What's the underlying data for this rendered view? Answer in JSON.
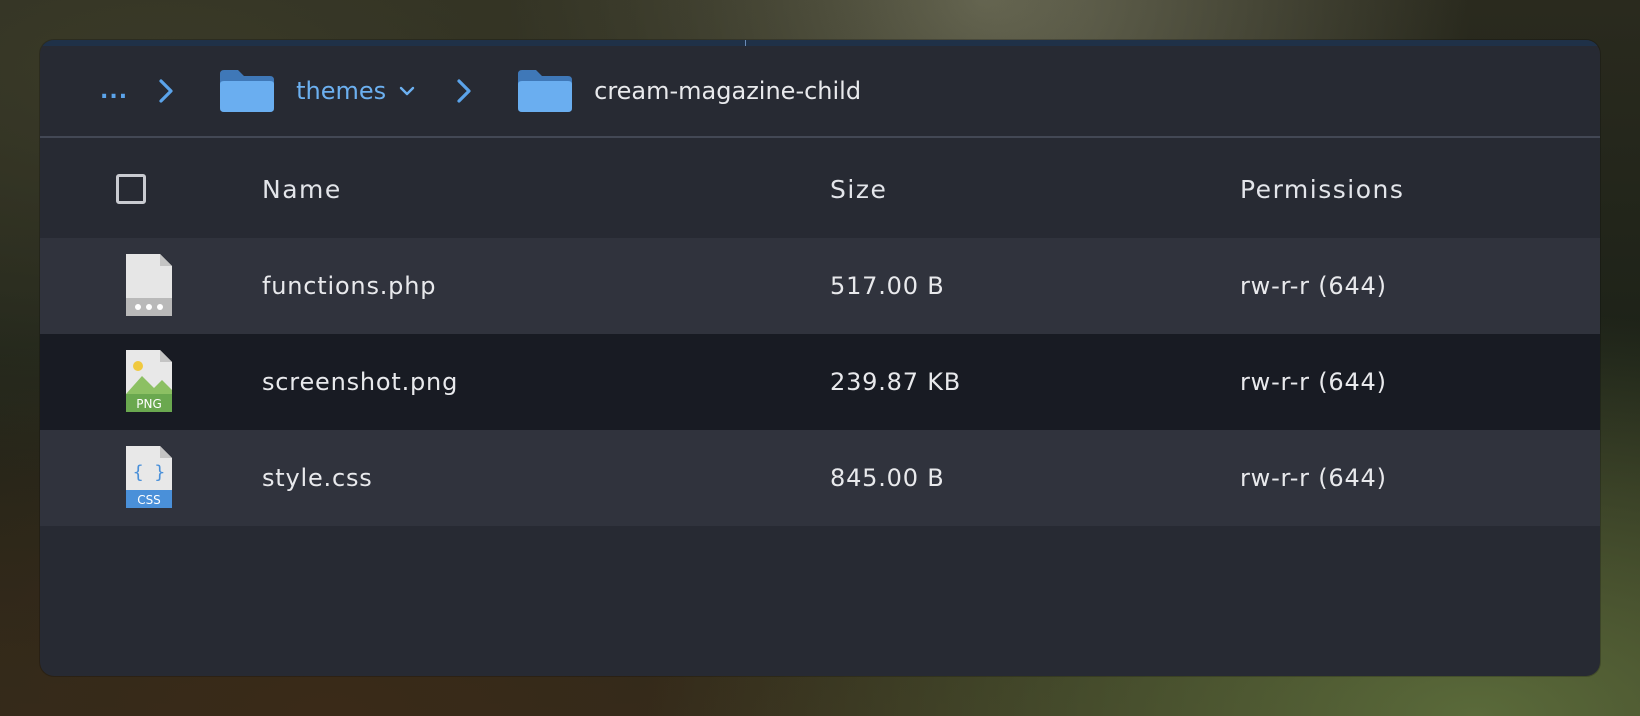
{
  "breadcrumb": {
    "ellipsis": "...",
    "parent": "themes",
    "current": "cream-magazine-child"
  },
  "columns": {
    "name": "Name",
    "size": "Size",
    "permissions": "Permissions"
  },
  "files": [
    {
      "name": "functions.php",
      "size": "517.00 B",
      "permissions": "rw-r-r (644)",
      "icon": "file-generic-icon"
    },
    {
      "name": "screenshot.png",
      "size": "239.87 KB",
      "permissions": "rw-r-r (644)",
      "icon": "png-file-icon",
      "icon_label": "PNG"
    },
    {
      "name": "style.css",
      "size": "845.00 B",
      "permissions": "rw-r-r (644)",
      "icon": "css-file-icon",
      "icon_label": "CSS",
      "icon_glyph": "{ }"
    }
  ],
  "colors": {
    "accent": "#6cb0f0",
    "panel": "#272a33",
    "row_alt": "#30333d",
    "row_selected": "#181b23",
    "folder": "#5b9bd5",
    "png_green": "#7ab648",
    "css_blue": "#4a90d9"
  }
}
